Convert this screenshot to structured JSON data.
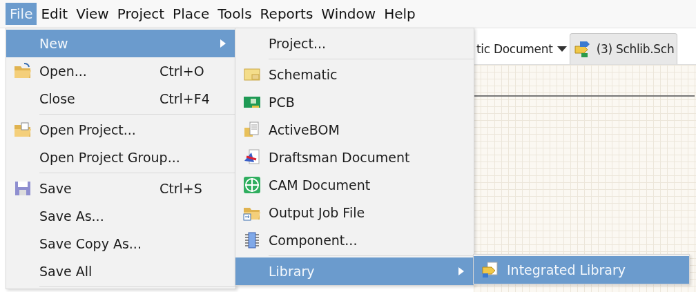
{
  "menu_bar": [
    {
      "label": "File",
      "selected": true
    },
    {
      "label": "Edit",
      "selected": false
    },
    {
      "label": "View",
      "selected": false
    },
    {
      "label": "Project",
      "selected": false
    },
    {
      "label": "Place",
      "selected": false
    },
    {
      "label": "Tools",
      "selected": false
    },
    {
      "label": "Reports",
      "selected": false
    },
    {
      "label": "Window",
      "selected": false
    },
    {
      "label": "Help",
      "selected": false
    }
  ],
  "document_tabs": [
    {
      "label": "tic Document",
      "selected": false
    },
    {
      "label": "(3) Schlib.Sch",
      "selected": true
    }
  ],
  "file_menu": [
    {
      "kind": "command",
      "label": "New",
      "submenu": true,
      "selected": true
    },
    {
      "kind": "command",
      "label": "Open...",
      "shortcut": "Ctrl+O",
      "selected": false
    },
    {
      "kind": "command",
      "label": "Close",
      "shortcut": "Ctrl+F4",
      "selected": false
    },
    {
      "kind": "separator"
    },
    {
      "kind": "command",
      "label": "Open Project...",
      "selected": false
    },
    {
      "kind": "command",
      "label": "Open Project Group...",
      "selected": false
    },
    {
      "kind": "separator"
    },
    {
      "kind": "command",
      "label": "Save",
      "shortcut": "Ctrl+S",
      "selected": false
    },
    {
      "kind": "command",
      "label": "Save As...",
      "selected": false
    },
    {
      "kind": "command",
      "label": "Save Copy As...",
      "selected": false
    },
    {
      "kind": "command",
      "label": "Save All",
      "selected": false
    },
    {
      "kind": "separator"
    }
  ],
  "new_menu": [
    {
      "kind": "command",
      "label": "Project...",
      "selected": false
    },
    {
      "kind": "separator"
    },
    {
      "kind": "command",
      "label": "Schematic",
      "selected": false
    },
    {
      "kind": "command",
      "label": "PCB",
      "selected": false
    },
    {
      "kind": "command",
      "label": "ActiveBOM",
      "selected": false
    },
    {
      "kind": "command",
      "label": "Draftsman Document",
      "selected": false
    },
    {
      "kind": "command",
      "label": "CAM Document",
      "selected": false
    },
    {
      "kind": "command",
      "label": "Output Job File",
      "selected": false
    },
    {
      "kind": "command",
      "label": "Component...",
      "selected": false
    },
    {
      "kind": "separator"
    },
    {
      "kind": "command",
      "label": "Library",
      "submenu": true,
      "selected": true
    }
  ],
  "library_menu": [
    {
      "kind": "command",
      "label": "Integrated Library",
      "selected": true
    }
  ]
}
